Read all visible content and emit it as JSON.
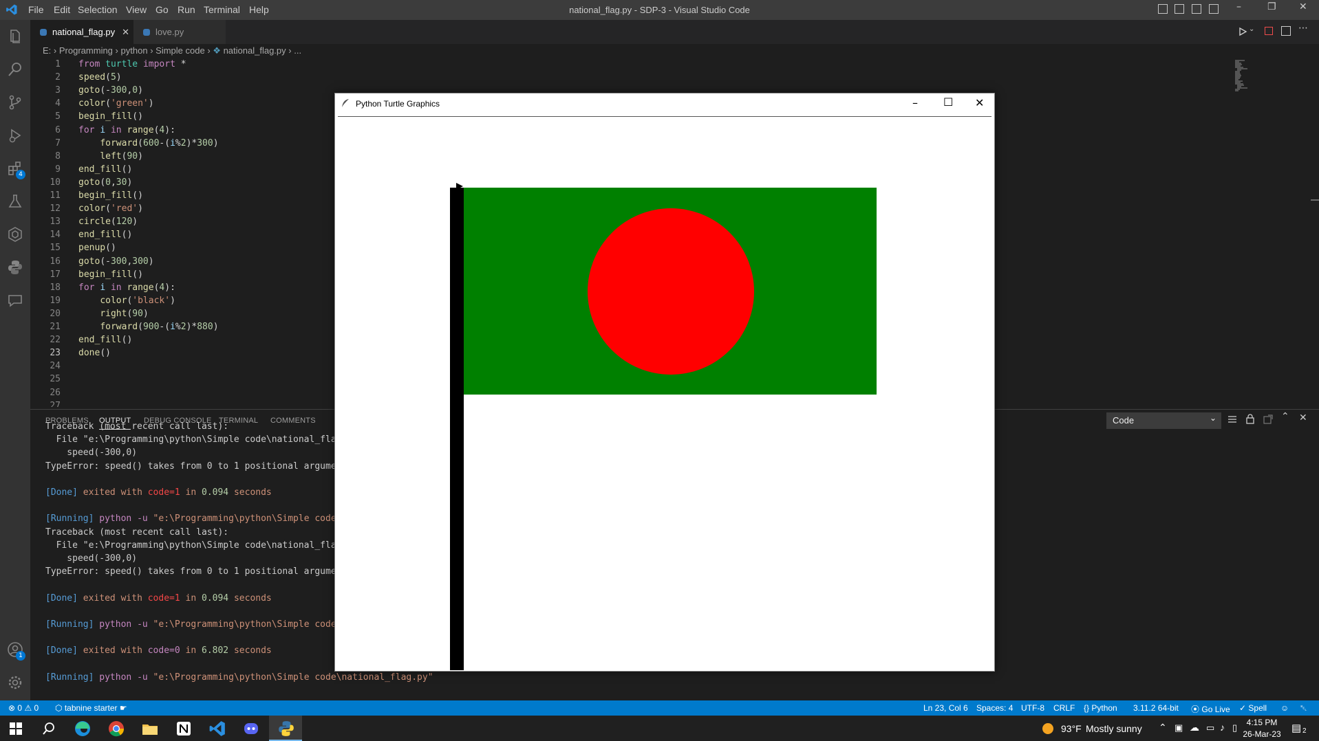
{
  "window": {
    "title": "national_flag.py - SDP-3 - Visual Studio Code",
    "menu": [
      "File",
      "Edit",
      "Selection",
      "View",
      "Go",
      "Run",
      "Terminal",
      "Help"
    ]
  },
  "activity_bar": {
    "icons": [
      "explorer-icon",
      "search-icon",
      "source-control-icon",
      "run-debug-icon",
      "extensions-icon",
      "testing-icon",
      "remote-icon",
      "python-icon",
      "comments-icon",
      "account-icon",
      "settings-icon"
    ],
    "extensions_badge": "4",
    "account_badge": "1"
  },
  "tabs": [
    {
      "label": "national_flag.py",
      "active": true
    },
    {
      "label": "love.py",
      "active": false
    }
  ],
  "breadcrumb": [
    "E:",
    "Programming",
    "python",
    "Simple code",
    "national_flag.py",
    "..."
  ],
  "editor": {
    "line_numbers": [
      "1",
      "2",
      "3",
      "4",
      "5",
      "6",
      "7",
      "8",
      "9",
      "10",
      "11",
      "12",
      "13",
      "14",
      "15",
      "16",
      "17",
      "18",
      "19",
      "20",
      "21",
      "22",
      "23",
      "24",
      "25",
      "26",
      "27"
    ],
    "current_line": "23",
    "lines": [
      "from turtle import *",
      "speed(5)",
      "goto(-300,0)",
      "color('green')",
      "begin_fill()",
      "for i in range(4):",
      "    forward(600-(i%2)*300)",
      "    left(90)",
      "end_fill()",
      "goto(0,30)",
      "begin_fill()",
      "color('red')",
      "circle(120)",
      "end_fill()",
      "penup()",
      "goto(-300,300)",
      "begin_fill()",
      "for i in range(4):",
      "    color('black')",
      "    right(90)",
      "    forward(900-(i%2)*880)",
      "end_fill()",
      "done()",
      "",
      "",
      "",
      ""
    ]
  },
  "panel": {
    "tabs": [
      "PROBLEMS",
      "OUTPUT",
      "DEBUG CONSOLE",
      "TERMINAL",
      "COMMENTS"
    ],
    "active_tab": "OUTPUT",
    "output_channel": "Code",
    "output_lines": [
      "Traceback (most recent call last):",
      "  File \"e:\\Programming\\python\\Simple code\\national_flag",
      "    speed(-300,0)",
      "TypeError: speed() takes from 0 to 1 positional argumen",
      "",
      "[Done] exited with code=1 in 0.094 seconds",
      "",
      "[Running] python -u \"e:\\Programming\\python\\Simple code\\",
      "Traceback (most recent call last):",
      "  File \"e:\\Programming\\python\\Simple code\\national_flag",
      "    speed(-300,0)",
      "TypeError: speed() takes from 0 to 1 positional argumen",
      "",
      "[Done] exited with code=1 in 0.094 seconds",
      "",
      "[Running] python -u \"e:\\Programming\\python\\Simple code\\",
      "",
      "[Done] exited with code=0 in 6.802 seconds",
      "",
      "[Running] python -u \"e:\\Programming\\python\\Simple code\\national_flag.py\""
    ]
  },
  "turtle_window": {
    "title": "Python Turtle Graphics",
    "flag_green": "#008000",
    "flag_red": "#ff0000",
    "pole_color": "#000000"
  },
  "status_bar": {
    "errors": "0",
    "warnings": "0",
    "tabnine": "tabnine starter",
    "position": "Ln 23, Col 6",
    "spaces": "Spaces: 4",
    "encoding": "UTF-8",
    "eol": "CRLF",
    "language": "Python",
    "interpreter": "3.11.2 64-bit",
    "go_live": "Go Live",
    "spell": "Spell",
    "accent": "#007acc"
  },
  "taskbar": {
    "apps": [
      "windows-start-icon",
      "search-icon",
      "edge-icon",
      "chrome-icon",
      "file-explorer-icon",
      "notion-icon",
      "vscode-icon",
      "discord-icon",
      "python-icon"
    ],
    "weather_temp": "93°F",
    "weather_text": "Mostly sunny",
    "time": "4:15 PM",
    "date": "26-Mar-23",
    "notifications": "2"
  }
}
